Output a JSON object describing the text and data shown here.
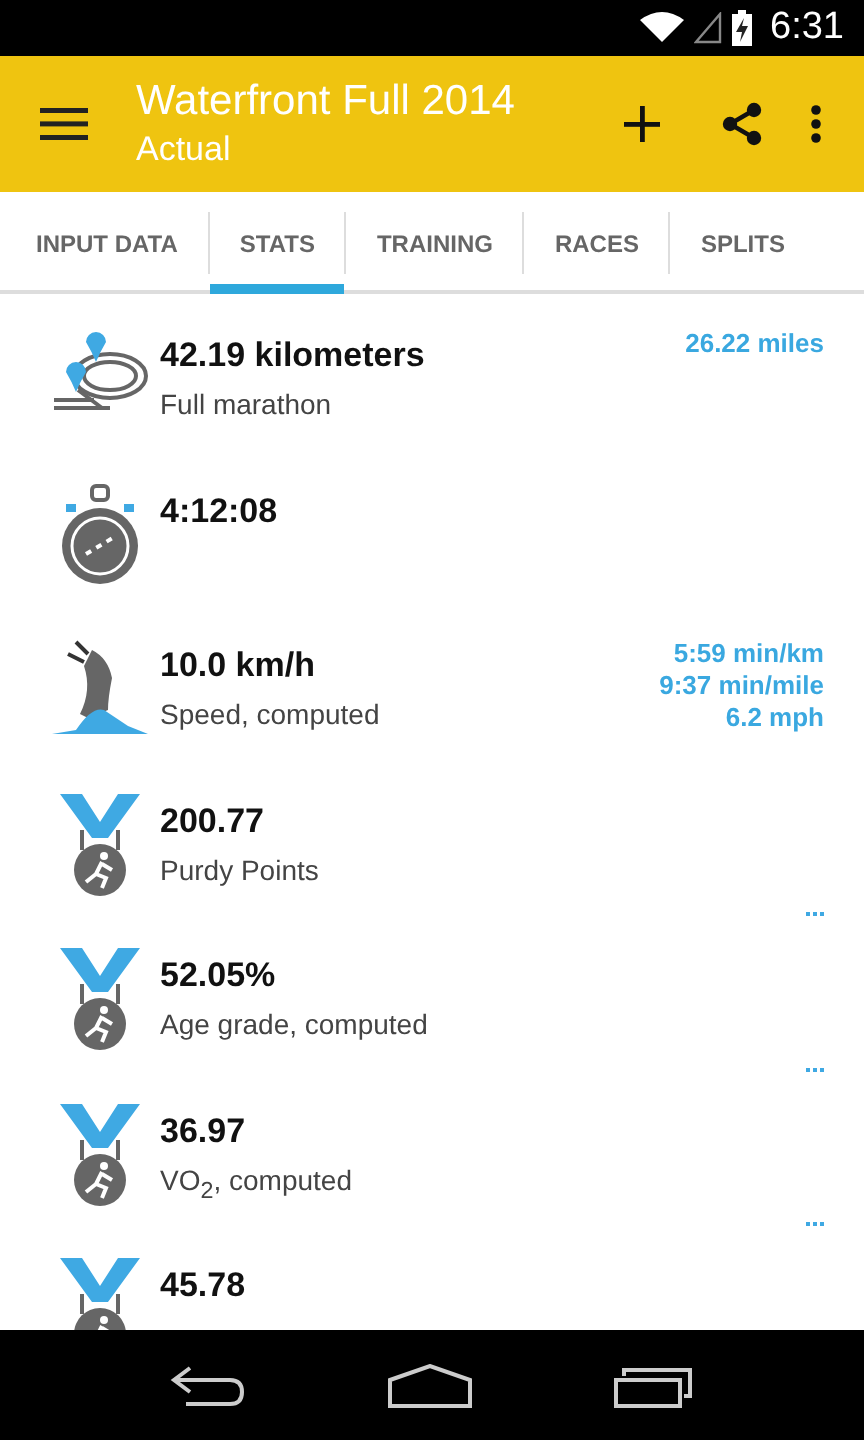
{
  "status_bar": {
    "time": "6:31"
  },
  "app_bar": {
    "title": "Waterfront Full 2014",
    "subtitle": "Actual"
  },
  "tabs": [
    {
      "label": "INPUT DATA",
      "selected": false
    },
    {
      "label": "STATS",
      "selected": true
    },
    {
      "label": "TRAINING",
      "selected": false
    },
    {
      "label": "RACES",
      "selected": false
    },
    {
      "label": "SPLITS",
      "selected": false
    }
  ],
  "stats": [
    {
      "kind": "distance",
      "value": "42.19 kilometers",
      "label": "Full marathon",
      "extras": [
        "26.22 miles"
      ]
    },
    {
      "kind": "time",
      "value": "4:12:08"
    },
    {
      "kind": "speed",
      "value": "10.0 km/h",
      "label": "Speed, computed",
      "extras": [
        "5:59 min/km",
        "9:37 min/mile",
        "6.2 mph"
      ]
    },
    {
      "kind": "medal",
      "value": "200.77",
      "label": "Purdy Points",
      "more": true
    },
    {
      "kind": "medal",
      "value": "52.05%",
      "label": "Age grade, computed",
      "more": true
    },
    {
      "kind": "medal",
      "value": "36.97",
      "label": "VO$_{2}$, computed",
      "more": true
    },
    {
      "kind": "medal",
      "value": "45.78"
    }
  ]
}
